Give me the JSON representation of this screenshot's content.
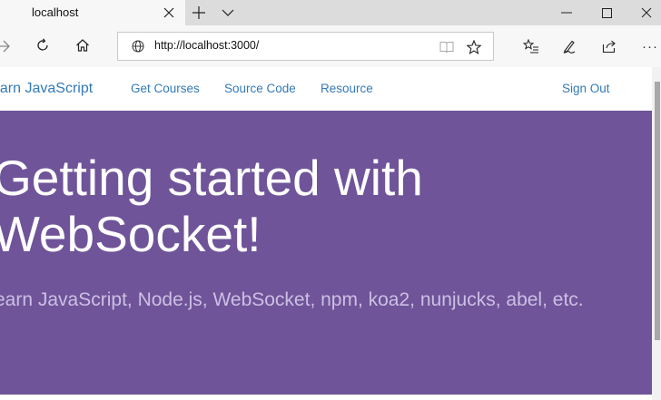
{
  "browser": {
    "tab": {
      "title": "localhost"
    },
    "address_bar": {
      "url": "http://localhost:3000/"
    }
  },
  "page": {
    "navbar": {
      "brand": "earn JavaScript",
      "links": [
        "Get Courses",
        "Source Code",
        "Resource"
      ],
      "sign_out": "Sign Out"
    },
    "hero": {
      "title": "Getting started with WebSocket!",
      "subtitle": "earn JavaScript, Node.js, WebSocket, npm, koa2, nunjucks, abel, etc."
    }
  },
  "colors": {
    "hero_background": "#6f5499",
    "link": "#337ab7",
    "hero_subtitle": "#cdbfe3"
  },
  "icons": {
    "tab_close": "close-icon",
    "new_tab": "plus-icon",
    "tab_list": "chevron-down-icon",
    "minimize": "minimize-icon",
    "maximize": "maximize-icon",
    "window_close": "close-icon",
    "back": "back-arrow-icon",
    "refresh": "refresh-icon",
    "home": "home-icon",
    "site_info": "globe-icon",
    "reading_view": "book-icon",
    "favorite": "star-icon",
    "favorites_list": "favorites-icon",
    "notes": "pen-icon",
    "share": "share-icon",
    "more": "more-icon"
  }
}
